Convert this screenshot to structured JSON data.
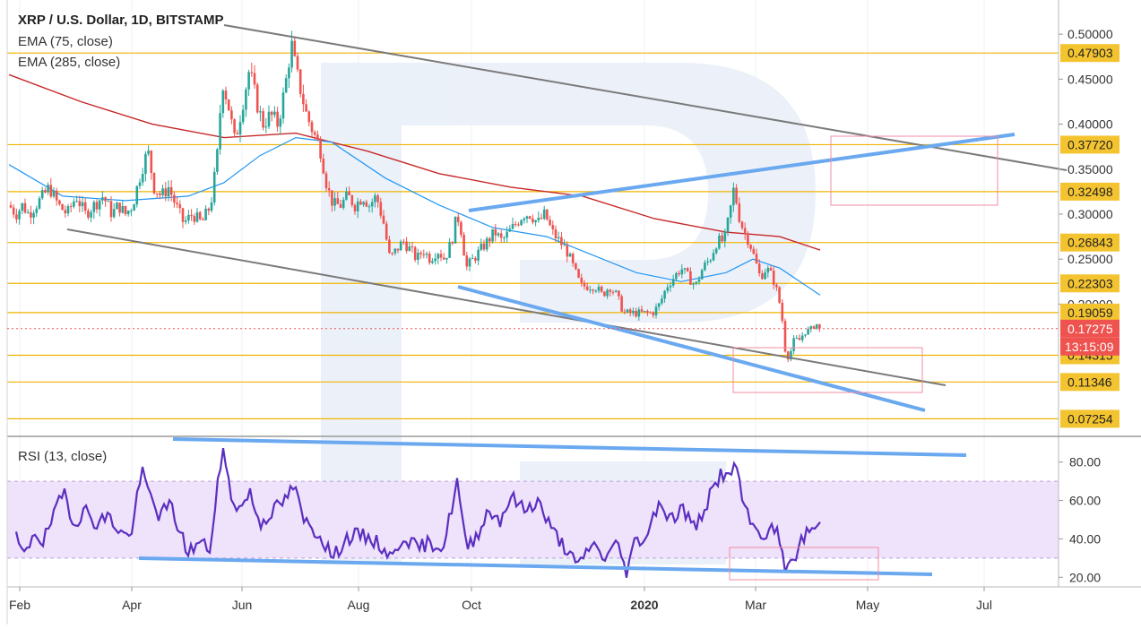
{
  "header": {
    "title": "XRP / U.S. Dollar, 1D, BITSTAMP",
    "ema75": "EMA (75, close)",
    "ema285": "EMA (285, close)",
    "rsi": "RSI (13, close)"
  },
  "colors": {
    "bull": "#26a69a",
    "bear": "#ef5350",
    "ema75": "#2196f3",
    "ema285": "#c62828",
    "level": "#f0b400",
    "level_tag": "#f4c430",
    "price_tag": "#ef5350",
    "trend_blue": "#6aa8f0",
    "trend_gray": "#7a7a7a",
    "rsi_line": "#5b2fbf",
    "rsi_band": "#efe2fb",
    "box": "#f08ca0"
  },
  "chart_data": [
    {
      "type": "candlestick",
      "title": "XRP / U.S. Dollar, 1D, BITSTAMP",
      "ylim": [
        0.06,
        0.53
      ],
      "x_ticks": [
        "Feb",
        "Apr",
        "Jun",
        "Aug",
        "Oct",
        "2020",
        "Mar",
        "May",
        "Jul"
      ],
      "y_ticks": [
        "0.50000",
        "0.45000",
        "0.40000",
        "0.35000",
        "0.30000",
        "0.25000",
        "0.20000"
      ],
      "levels": [
        "0.47903",
        "0.37720",
        "0.32498",
        "0.26843",
        "0.22303",
        "0.19059",
        "0.14315",
        "0.11346",
        "0.07254"
      ],
      "current_price": "0.17275",
      "countdown": "13:15:09",
      "close_series": [
        {
          "t": 0,
          "v": 0.31
        },
        {
          "t": 8,
          "v": 0.3
        },
        {
          "t": 15,
          "v": 0.31
        },
        {
          "t": 22,
          "v": 0.3
        },
        {
          "t": 30,
          "v": 0.31
        },
        {
          "t": 38,
          "v": 0.32
        },
        {
          "t": 45,
          "v": 0.33
        },
        {
          "t": 55,
          "v": 0.31
        },
        {
          "t": 65,
          "v": 0.3
        },
        {
          "t": 75,
          "v": 0.32
        },
        {
          "t": 85,
          "v": 0.3
        },
        {
          "t": 95,
          "v": 0.31
        },
        {
          "t": 105,
          "v": 0.32
        },
        {
          "t": 115,
          "v": 0.3
        },
        {
          "t": 122,
          "v": 0.31
        },
        {
          "t": 130,
          "v": 0.3
        },
        {
          "t": 138,
          "v": 0.31
        },
        {
          "t": 148,
          "v": 0.35
        },
        {
          "t": 155,
          "v": 0.37
        },
        {
          "t": 162,
          "v": 0.33
        },
        {
          "t": 170,
          "v": 0.32
        },
        {
          "t": 178,
          "v": 0.33
        },
        {
          "t": 186,
          "v": 0.31
        },
        {
          "t": 195,
          "v": 0.29
        },
        {
          "t": 205,
          "v": 0.3
        },
        {
          "t": 215,
          "v": 0.29
        },
        {
          "t": 225,
          "v": 0.31
        },
        {
          "t": 232,
          "v": 0.36
        },
        {
          "t": 238,
          "v": 0.45
        },
        {
          "t": 245,
          "v": 0.42
        },
        {
          "t": 252,
          "v": 0.38
        },
        {
          "t": 260,
          "v": 0.42
        },
        {
          "t": 268,
          "v": 0.46
        },
        {
          "t": 275,
          "v": 0.43
        },
        {
          "t": 283,
          "v": 0.4
        },
        {
          "t": 292,
          "v": 0.41
        },
        {
          "t": 300,
          "v": 0.4
        },
        {
          "t": 308,
          "v": 0.44
        },
        {
          "t": 315,
          "v": 0.49
        },
        {
          "t": 320,
          "v": 0.46
        },
        {
          "t": 325,
          "v": 0.44
        },
        {
          "t": 332,
          "v": 0.41
        },
        {
          "t": 340,
          "v": 0.39
        },
        {
          "t": 348,
          "v": 0.37
        },
        {
          "t": 355,
          "v": 0.33
        },
        {
          "t": 362,
          "v": 0.31
        },
        {
          "t": 370,
          "v": 0.31
        },
        {
          "t": 378,
          "v": 0.32
        },
        {
          "t": 386,
          "v": 0.31
        },
        {
          "t": 395,
          "v": 0.32
        },
        {
          "t": 402,
          "v": 0.31
        },
        {
          "t": 410,
          "v": 0.32
        },
        {
          "t": 418,
          "v": 0.29
        },
        {
          "t": 425,
          "v": 0.25
        },
        {
          "t": 432,
          "v": 0.26
        },
        {
          "t": 440,
          "v": 0.27
        },
        {
          "t": 448,
          "v": 0.26
        },
        {
          "t": 455,
          "v": 0.25
        },
        {
          "t": 462,
          "v": 0.26
        },
        {
          "t": 470,
          "v": 0.25
        },
        {
          "t": 478,
          "v": 0.26
        },
        {
          "t": 486,
          "v": 0.25
        },
        {
          "t": 494,
          "v": 0.27
        },
        {
          "t": 500,
          "v": 0.3
        },
        {
          "t": 505,
          "v": 0.28
        },
        {
          "t": 510,
          "v": 0.24
        },
        {
          "t": 518,
          "v": 0.25
        },
        {
          "t": 526,
          "v": 0.26
        },
        {
          "t": 534,
          "v": 0.27
        },
        {
          "t": 542,
          "v": 0.28
        },
        {
          "t": 550,
          "v": 0.27
        },
        {
          "t": 558,
          "v": 0.28
        },
        {
          "t": 566,
          "v": 0.29
        },
        {
          "t": 574,
          "v": 0.3
        },
        {
          "t": 582,
          "v": 0.3
        },
        {
          "t": 590,
          "v": 0.29
        },
        {
          "t": 598,
          "v": 0.3
        },
        {
          "t": 606,
          "v": 0.28
        },
        {
          "t": 614,
          "v": 0.27
        },
        {
          "t": 622,
          "v": 0.26
        },
        {
          "t": 630,
          "v": 0.24
        },
        {
          "t": 638,
          "v": 0.22
        },
        {
          "t": 646,
          "v": 0.22
        },
        {
          "t": 654,
          "v": 0.22
        },
        {
          "t": 662,
          "v": 0.21
        },
        {
          "t": 670,
          "v": 0.22
        },
        {
          "t": 678,
          "v": 0.21
        },
        {
          "t": 686,
          "v": 0.19
        },
        {
          "t": 694,
          "v": 0.19
        },
        {
          "t": 702,
          "v": 0.19
        },
        {
          "t": 710,
          "v": 0.19
        },
        {
          "t": 718,
          "v": 0.19
        },
        {
          "t": 726,
          "v": 0.2
        },
        {
          "t": 734,
          "v": 0.22
        },
        {
          "t": 742,
          "v": 0.23
        },
        {
          "t": 750,
          "v": 0.24
        },
        {
          "t": 758,
          "v": 0.23
        },
        {
          "t": 766,
          "v": 0.22
        },
        {
          "t": 774,
          "v": 0.24
        },
        {
          "t": 782,
          "v": 0.25
        },
        {
          "t": 790,
          "v": 0.27
        },
        {
          "t": 798,
          "v": 0.27
        },
        {
          "t": 804,
          "v": 0.3
        },
        {
          "t": 809,
          "v": 0.33
        },
        {
          "t": 814,
          "v": 0.3
        },
        {
          "t": 820,
          "v": 0.28
        },
        {
          "t": 826,
          "v": 0.27
        },
        {
          "t": 832,
          "v": 0.25
        },
        {
          "t": 838,
          "v": 0.23
        },
        {
          "t": 845,
          "v": 0.24
        },
        {
          "t": 852,
          "v": 0.23
        },
        {
          "t": 858,
          "v": 0.21
        },
        {
          "t": 862,
          "v": 0.19
        },
        {
          "t": 866,
          "v": 0.15
        },
        {
          "t": 870,
          "v": 0.14
        },
        {
          "t": 876,
          "v": 0.16
        },
        {
          "t": 882,
          "v": 0.16
        },
        {
          "t": 888,
          "v": 0.17
        },
        {
          "t": 894,
          "v": 0.17
        },
        {
          "t": 900,
          "v": 0.18
        },
        {
          "t": 905,
          "v": 0.17
        }
      ],
      "ema75": [
        {
          "t": 0,
          "v": 0.355
        },
        {
          "t": 60,
          "v": 0.32
        },
        {
          "t": 130,
          "v": 0.315
        },
        {
          "t": 200,
          "v": 0.32
        },
        {
          "t": 240,
          "v": 0.335
        },
        {
          "t": 280,
          "v": 0.365
        },
        {
          "t": 320,
          "v": 0.385
        },
        {
          "t": 360,
          "v": 0.38
        },
        {
          "t": 420,
          "v": 0.34
        },
        {
          "t": 480,
          "v": 0.31
        },
        {
          "t": 540,
          "v": 0.285
        },
        {
          "t": 600,
          "v": 0.275
        },
        {
          "t": 650,
          "v": 0.255
        },
        {
          "t": 700,
          "v": 0.235
        },
        {
          "t": 750,
          "v": 0.225
        },
        {
          "t": 800,
          "v": 0.235
        },
        {
          "t": 830,
          "v": 0.25
        },
        {
          "t": 860,
          "v": 0.24
        },
        {
          "t": 905,
          "v": 0.21
        }
      ],
      "ema285": [
        {
          "t": 0,
          "v": 0.455
        },
        {
          "t": 80,
          "v": 0.425
        },
        {
          "t": 160,
          "v": 0.4
        },
        {
          "t": 240,
          "v": 0.385
        },
        {
          "t": 320,
          "v": 0.39
        },
        {
          "t": 400,
          "v": 0.37
        },
        {
          "t": 480,
          "v": 0.345
        },
        {
          "t": 560,
          "v": 0.33
        },
        {
          "t": 640,
          "v": 0.32
        },
        {
          "t": 720,
          "v": 0.295
        },
        {
          "t": 800,
          "v": 0.28
        },
        {
          "t": 860,
          "v": 0.275
        },
        {
          "t": 905,
          "v": 0.26
        }
      ]
    },
    {
      "type": "line",
      "title": "RSI (13, close)",
      "ylim": [
        15,
        92
      ],
      "y_ticks": [
        "80.00",
        "60.00",
        "40.00",
        "20.00"
      ],
      "band": [
        30,
        70
      ],
      "series": [
        {
          "t": 8,
          "v": 40
        },
        {
          "t": 18,
          "v": 30
        },
        {
          "t": 28,
          "v": 45
        },
        {
          "t": 38,
          "v": 38
        },
        {
          "t": 50,
          "v": 52
        },
        {
          "t": 62,
          "v": 65
        },
        {
          "t": 72,
          "v": 48
        },
        {
          "t": 85,
          "v": 55
        },
        {
          "t": 98,
          "v": 48
        },
        {
          "t": 110,
          "v": 52
        },
        {
          "t": 122,
          "v": 45
        },
        {
          "t": 135,
          "v": 40
        },
        {
          "t": 148,
          "v": 75
        },
        {
          "t": 158,
          "v": 62
        },
        {
          "t": 168,
          "v": 52
        },
        {
          "t": 180,
          "v": 58
        },
        {
          "t": 192,
          "v": 42
        },
        {
          "t": 200,
          "v": 33
        },
        {
          "t": 212,
          "v": 38
        },
        {
          "t": 225,
          "v": 35
        },
        {
          "t": 238,
          "v": 88
        },
        {
          "t": 248,
          "v": 62
        },
        {
          "t": 258,
          "v": 55
        },
        {
          "t": 268,
          "v": 65
        },
        {
          "t": 280,
          "v": 48
        },
        {
          "t": 295,
          "v": 55
        },
        {
          "t": 308,
          "v": 60
        },
        {
          "t": 318,
          "v": 68
        },
        {
          "t": 328,
          "v": 50
        },
        {
          "t": 340,
          "v": 45
        },
        {
          "t": 350,
          "v": 40
        },
        {
          "t": 362,
          "v": 30
        },
        {
          "t": 375,
          "v": 40
        },
        {
          "t": 390,
          "v": 42
        },
        {
          "t": 405,
          "v": 40
        },
        {
          "t": 418,
          "v": 35
        },
        {
          "t": 428,
          "v": 30
        },
        {
          "t": 440,
          "v": 42
        },
        {
          "t": 455,
          "v": 35
        },
        {
          "t": 470,
          "v": 38
        },
        {
          "t": 485,
          "v": 36
        },
        {
          "t": 500,
          "v": 70
        },
        {
          "t": 510,
          "v": 35
        },
        {
          "t": 522,
          "v": 42
        },
        {
          "t": 535,
          "v": 55
        },
        {
          "t": 548,
          "v": 50
        },
        {
          "t": 560,
          "v": 62
        },
        {
          "t": 575,
          "v": 55
        },
        {
          "t": 590,
          "v": 60
        },
        {
          "t": 605,
          "v": 45
        },
        {
          "t": 620,
          "v": 36
        },
        {
          "t": 635,
          "v": 25
        },
        {
          "t": 650,
          "v": 38
        },
        {
          "t": 665,
          "v": 30
        },
        {
          "t": 680,
          "v": 38
        },
        {
          "t": 688,
          "v": 22
        },
        {
          "t": 698,
          "v": 38
        },
        {
          "t": 712,
          "v": 42
        },
        {
          "t": 725,
          "v": 60
        },
        {
          "t": 738,
          "v": 50
        },
        {
          "t": 752,
          "v": 56
        },
        {
          "t": 765,
          "v": 45
        },
        {
          "t": 780,
          "v": 60
        },
        {
          "t": 795,
          "v": 75
        },
        {
          "t": 805,
          "v": 70
        },
        {
          "t": 810,
          "v": 83
        },
        {
          "t": 820,
          "v": 55
        },
        {
          "t": 832,
          "v": 45
        },
        {
          "t": 845,
          "v": 42
        },
        {
          "t": 855,
          "v": 46
        },
        {
          "t": 862,
          "v": 35
        },
        {
          "t": 868,
          "v": 22
        },
        {
          "t": 876,
          "v": 30
        },
        {
          "t": 885,
          "v": 40
        },
        {
          "t": 894,
          "v": 45
        },
        {
          "t": 905,
          "v": 47
        }
      ]
    }
  ]
}
